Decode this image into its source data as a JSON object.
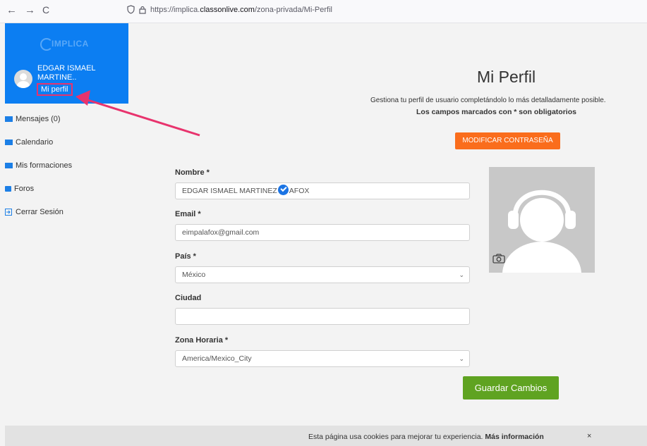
{
  "browser": {
    "back": "←",
    "forward": "→",
    "reload": "C",
    "url_prefix": "https://implica.",
    "url_domain": "classonlive.com",
    "url_path": "/zona-privada/Mi-Perfil"
  },
  "sidebar": {
    "logo": "IMPLICA",
    "user_name": "EDGAR ISMAEL MARTINE..",
    "profile_link": "Mi perfil",
    "items": [
      {
        "label": "Mensajes (0)",
        "icon": "envelope-icon"
      },
      {
        "label": "Calendario",
        "icon": "envelope-icon"
      },
      {
        "label": "Mis formaciones",
        "icon": "book-icon"
      },
      {
        "label": "Foros",
        "icon": "comment-icon"
      },
      {
        "label": "Cerrar Sesión",
        "icon": "logout-icon"
      }
    ]
  },
  "main": {
    "title": "Mi Perfil",
    "subtitle": "Gestiona tu perfil de usuario completándolo lo más detalladamente posible.",
    "required_note": "Los campos marcados con * son obligatorios",
    "change_password": "MODIFICAR CONTRASEÑA",
    "save": "Guardar Cambios"
  },
  "form": {
    "name_label": "Nombre *",
    "name_value_start": "EDGAR ISMAEL MARTINEZ",
    "name_value_end": "AFOX",
    "email_label": "Email *",
    "email_value": "eimpalafox@gmail.com",
    "country_label": "País *",
    "country_value": "México",
    "city_label": "Ciudad",
    "city_value": "",
    "timezone_label": "Zona Horaria *",
    "timezone_value": "America/Mexico_City"
  },
  "cookie": {
    "text": "Esta página usa cookies para mejorar tu experiencia.",
    "link": "Más información",
    "close": "×"
  },
  "colors": {
    "sidebar_blue": "#0c7ef2",
    "orange": "#fa6d1c",
    "green": "#5fa321",
    "highlight_pink": "#e8336d"
  }
}
